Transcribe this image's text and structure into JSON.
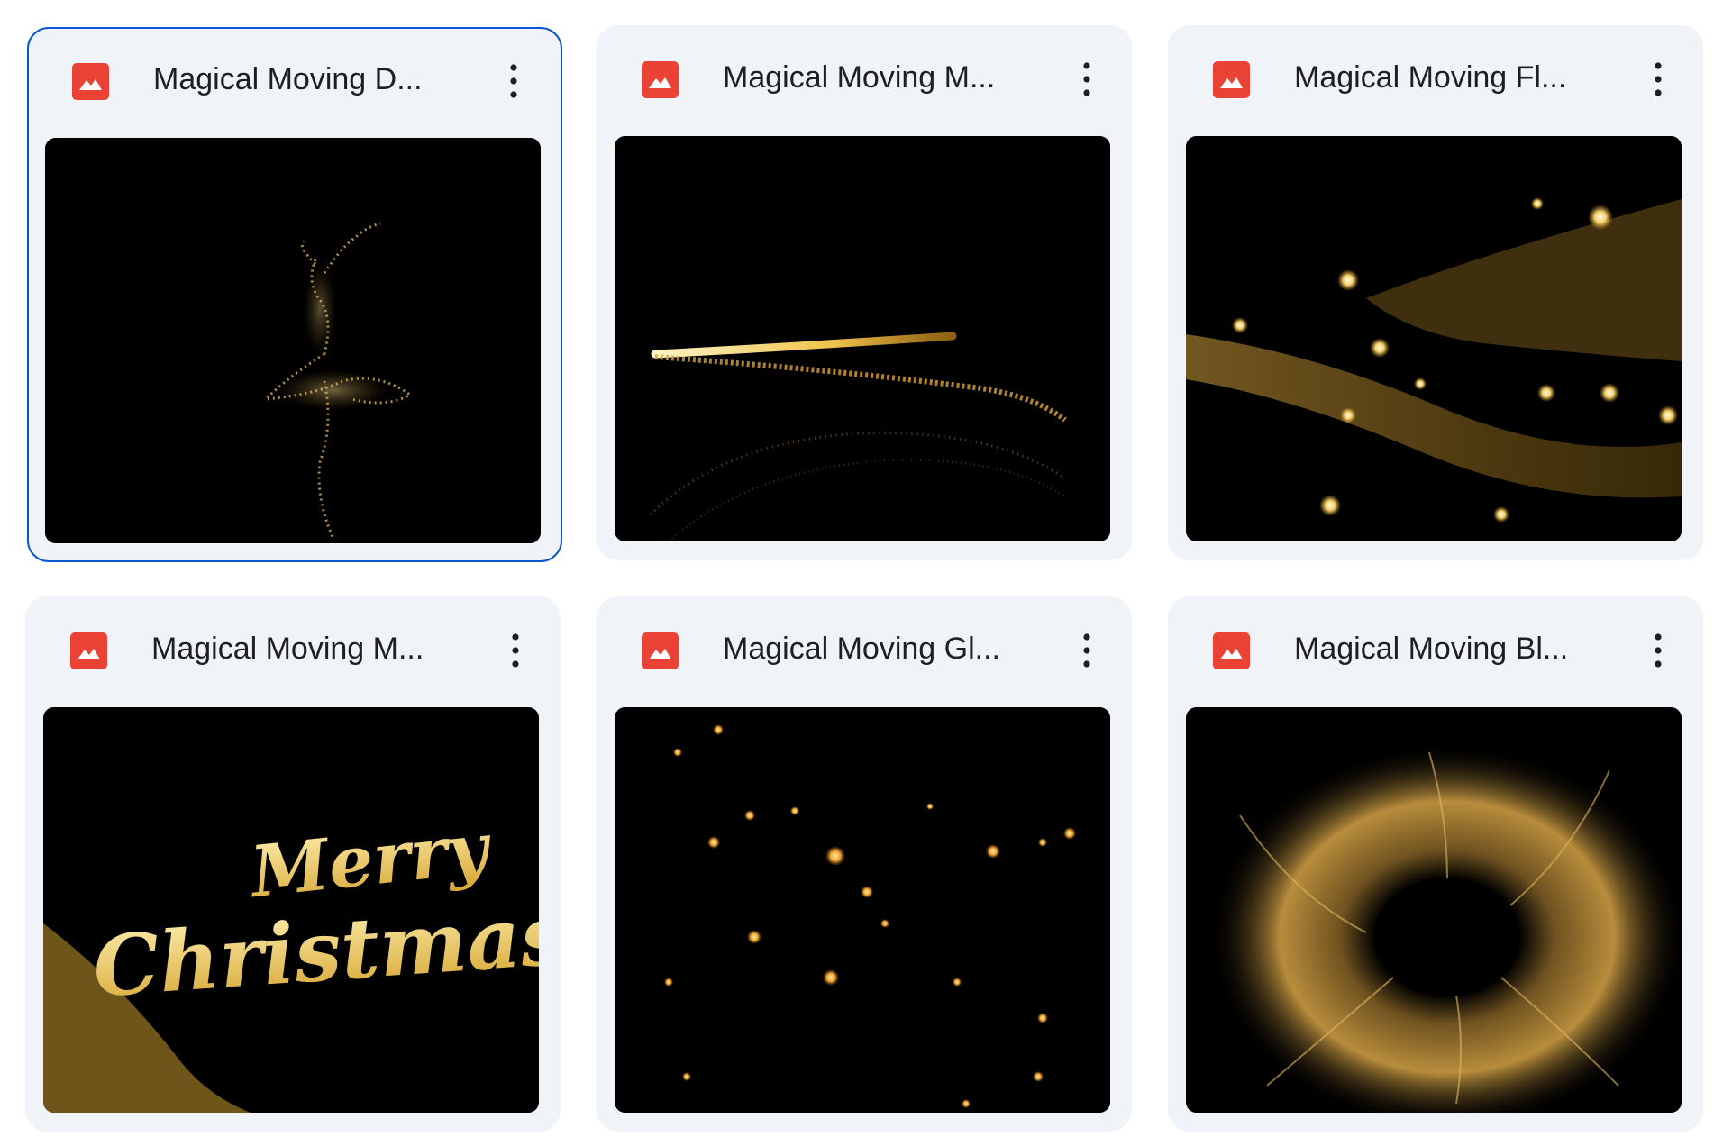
{
  "files": [
    {
      "title": "Magical Moving D...",
      "selected": true,
      "thumbnail": "gold-particle-ballerina"
    },
    {
      "title": "Magical Moving M...",
      "selected": false,
      "thumbnail": "gold-light-streak"
    },
    {
      "title": "Magical Moving Fl...",
      "selected": false,
      "thumbnail": "gold-bokeh-flow"
    },
    {
      "title": "Magical Moving M...",
      "selected": false,
      "thumbnail": "gold-merry-christmas-script"
    },
    {
      "title": "Magical Moving Gl...",
      "selected": false,
      "thumbnail": "gold-floating-sparks"
    },
    {
      "title": "Magical Moving Bl...",
      "selected": false,
      "thumbnail": "gold-particle-burst"
    }
  ],
  "thumbnail_text": {
    "merry": "Merry",
    "christmas": "Christmas"
  },
  "colors": {
    "card_bg": "#f0f4f9",
    "selected_border": "#0b57d0",
    "file_icon": "#ea4335",
    "title_text": "#1f1f1f",
    "gold": "#e8b84a"
  },
  "icons": {
    "file_type": "image-file-icon",
    "more": "more-vert-icon"
  }
}
